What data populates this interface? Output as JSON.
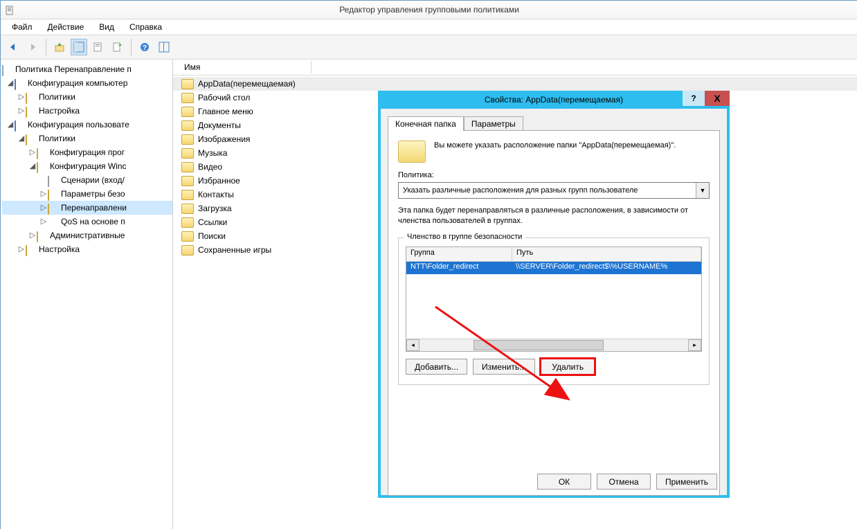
{
  "window": {
    "title": "Редактор управления групповыми политиками"
  },
  "menu": {
    "file": "Файл",
    "action": "Действие",
    "view": "Вид",
    "help": "Справка"
  },
  "tree": {
    "root": "Политика Перенаправление п",
    "comp_conf": "Конфигурация компьютер",
    "comp_policies": "Политики",
    "comp_settings": "Настройка",
    "user_conf": "Конфигурация пользовате",
    "user_policies": "Политики",
    "soft_conf": "Конфигурация прог",
    "win_conf": "Конфигурация Winc",
    "scripts": "Сценарии (вход/",
    "security": "Параметры безо",
    "redirect": "Перенаправлени",
    "qos": "QoS на основе п",
    "admin": "Административные",
    "user_settings": "Настройка"
  },
  "list": {
    "header": "Имя",
    "items": [
      "AppData(перемещаемая)",
      "Рабочий стол",
      "Главное меню",
      "Документы",
      "Изображения",
      "Музыка",
      "Видео",
      "Избранное",
      "Контакты",
      "Загрузка",
      "Ссылки",
      "Поиски",
      "Сохраненные игры"
    ]
  },
  "dialog": {
    "title": "Свойства: AppData(перемещаемая)",
    "help": "?",
    "close": "X",
    "tab_target": "Конечная папка",
    "tab_params": "Параметры",
    "intro": "Вы можете указать расположение папки \"AppData(перемещаемая)\".",
    "policy_label": "Политика:",
    "policy_value": "Указать различные расположения для разных групп пользователе",
    "policy_desc": "Эта папка будет перенаправляться в различные расположения, в зависимости от членства пользователей в группах.",
    "group_legend": "Членство в группе безопасности",
    "col_group": "Группа",
    "col_path": "Путь",
    "row_group": "NTT\\Folder_redirect",
    "row_path": "\\\\SERVER\\Folder_redirect$\\%USERNAME%",
    "btn_add": "Добавить...",
    "btn_edit": "Изменить...",
    "btn_del": "Удалить",
    "btn_ok": "ОК",
    "btn_cancel": "Отмена",
    "btn_apply": "Применить"
  }
}
